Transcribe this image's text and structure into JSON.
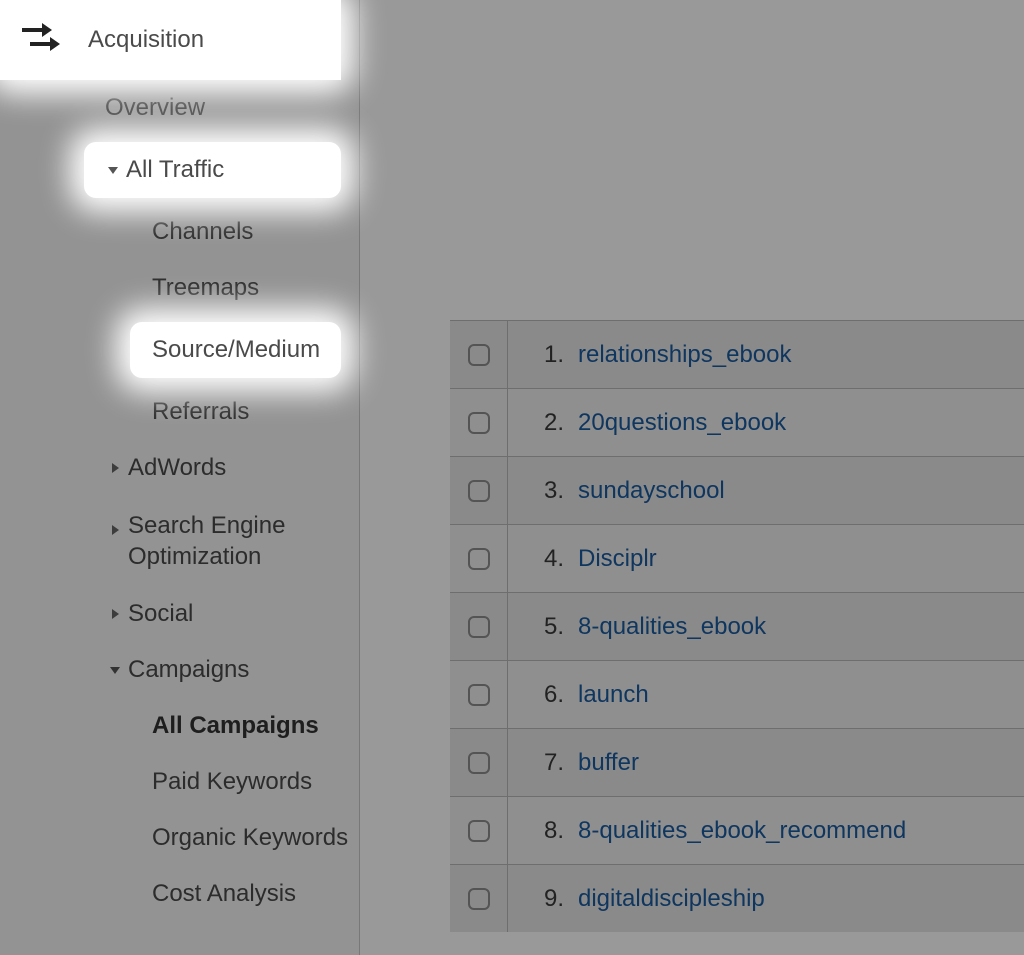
{
  "sidebar": {
    "top": {
      "label": "Acquisition"
    },
    "overview": "Overview",
    "groups": {
      "all_traffic": {
        "label": "All Traffic",
        "children": {
          "channels": "Channels",
          "treemaps": "Treemaps",
          "source_medium": "Source/Medium",
          "referrals": "Referrals"
        }
      },
      "adwords": {
        "label": "AdWords"
      },
      "seo": {
        "label": "Search Engine Optimization"
      },
      "social": {
        "label": "Social"
      },
      "campaigns": {
        "label": "Campaigns",
        "children": {
          "all_campaigns": "All Campaigns",
          "paid_keywords": "Paid Keywords",
          "organic_keywords": "Organic Keywords",
          "cost_analysis": "Cost Analysis"
        }
      }
    }
  },
  "table": {
    "rows": [
      {
        "n": "1.",
        "label": "relationships_ebook"
      },
      {
        "n": "2.",
        "label": "20questions_ebook"
      },
      {
        "n": "3.",
        "label": "sundayschool"
      },
      {
        "n": "4.",
        "label": "Disciplr"
      },
      {
        "n": "5.",
        "label": "8-qualities_ebook"
      },
      {
        "n": "6.",
        "label": "launch"
      },
      {
        "n": "7.",
        "label": "buffer"
      },
      {
        "n": "8.",
        "label": "8-qualities_ebook_recommend"
      },
      {
        "n": "9.",
        "label": "digitaldiscipleship"
      }
    ]
  }
}
